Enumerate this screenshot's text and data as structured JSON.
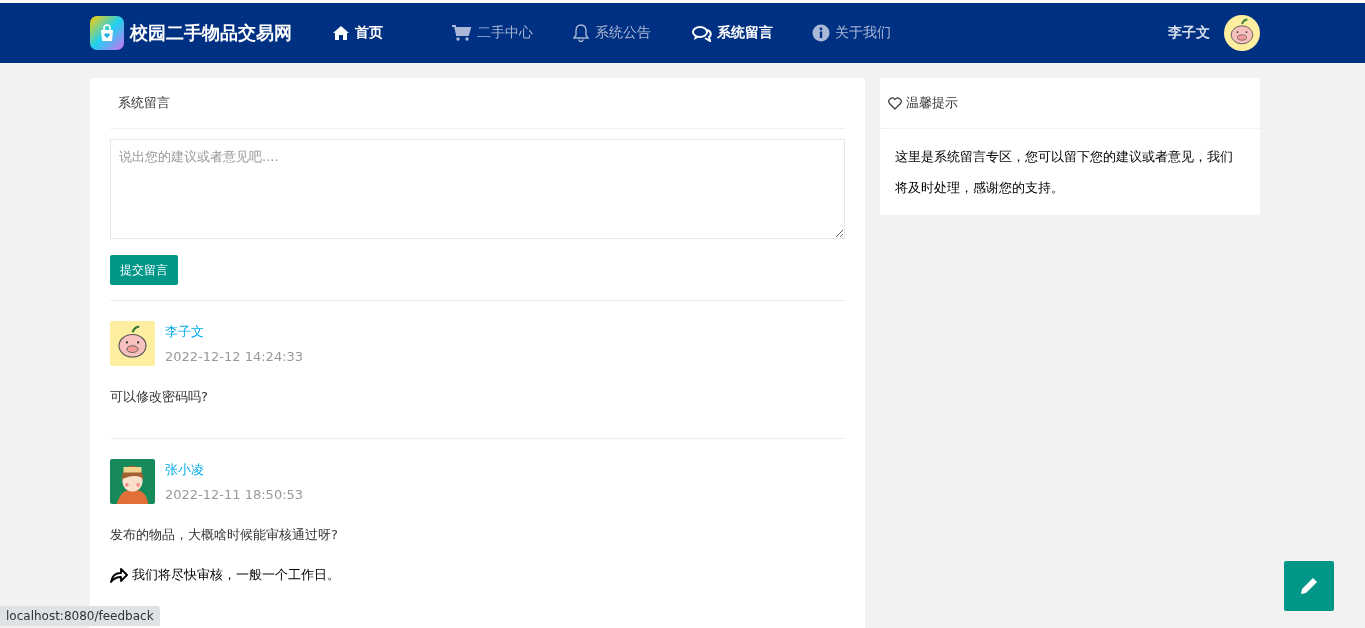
{
  "header": {
    "brand": "校园二手物品交易网",
    "nav": [
      {
        "label": "首页",
        "kind": "home",
        "selected": true
      },
      {
        "label": "二手中心",
        "kind": "cart",
        "selected": false
      },
      {
        "label": "系统公告",
        "kind": "bell",
        "selected": false
      },
      {
        "label": "系统留言",
        "kind": "chat",
        "selected": true
      },
      {
        "label": "关于我们",
        "kind": "info",
        "selected": false
      }
    ],
    "user": "李子文"
  },
  "feedback": {
    "title": "系统留言",
    "placeholder": "说出您的建议或者意见吧....",
    "submit": "提交留言",
    "messages": [
      {
        "name": "李子文",
        "time": "2022-12-12 14:24:33",
        "kind": "pig",
        "content": "可以修改密码吗?"
      },
      {
        "name": "张小凌",
        "time": "2022-12-11 18:50:53",
        "kind": "girl",
        "content": "发布的物品，大概啥时候能审核通过呀?",
        "reply": "我们将尽快审核，一般一个工作日。"
      }
    ]
  },
  "tips": {
    "title": "温馨提示",
    "text": "这里是系统留言专区，您可以留下您的建议或者意见，我们将及时处理，感谢您的支持。"
  },
  "status_url": "localhost:8080/feedback"
}
